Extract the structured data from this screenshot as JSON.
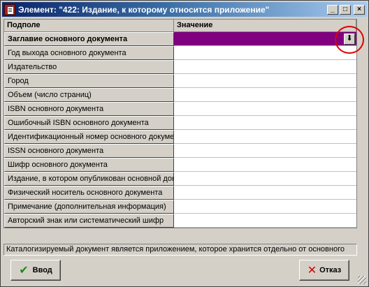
{
  "window": {
    "title": "Элемент: \"422: Издание, к которому относится  приложение\""
  },
  "title_buttons": {
    "minimize": "_",
    "maximize": "□",
    "close": "×"
  },
  "grid": {
    "col_name": "Подполе",
    "col_value": "Значение",
    "rows": [
      {
        "label": "Заглавие основного документа",
        "value": ""
      },
      {
        "label": "Год выхода основного документа",
        "value": ""
      },
      {
        "label": "Издательство",
        "value": ""
      },
      {
        "label": "Город",
        "value": ""
      },
      {
        "label": "Объем (число страниц)",
        "value": ""
      },
      {
        "label": "ISBN основного документа",
        "value": ""
      },
      {
        "label": "Ошибочный ISBN основного документа",
        "value": ""
      },
      {
        "label": "Идентификационный номер основного документа",
        "value": ""
      },
      {
        "label": "ISSN основного документа",
        "value": ""
      },
      {
        "label": "Шифр основного документа",
        "value": ""
      },
      {
        "label": "Издание, в котором опубликован основной документ",
        "value": ""
      },
      {
        "label": "Физический носитель основного документа",
        "value": ""
      },
      {
        "label": "Примечание (дополнительная информация)",
        "value": ""
      },
      {
        "label": "Авторский знак или систематический шифр",
        "value": ""
      }
    ],
    "dropdown_glyph": "⬇"
  },
  "status": {
    "text": "Каталогизируемый документ является приложением, которое хранится  отдельно от основного"
  },
  "buttons": {
    "ok_label": "Ввод",
    "ok_icon": "✔",
    "cancel_label": "Отказ",
    "cancel_icon": "✕"
  },
  "colors": {
    "titlebar_start": "#0a246a",
    "titlebar_end": "#a6caf0",
    "selected_value": "#800080",
    "highlight_circle": "#e00000"
  }
}
